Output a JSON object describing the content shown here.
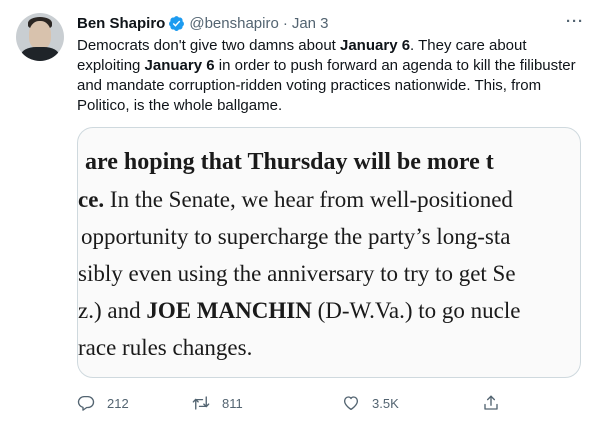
{
  "author": {
    "name": "Ben Shapiro",
    "handle": "@benshapiro",
    "separator": "·",
    "date": "Jan 3"
  },
  "more_label": "···",
  "tweet": {
    "parts": [
      "Democrats don't give two damns about ",
      "January 6",
      ". They care about exploiting ",
      "January 6",
      " in order to push forward an agenda to kill the filibuster and mandate corruption-ridden voting practices nationwide. This, from Politico, is the whole ballgame."
    ]
  },
  "media": {
    "lines": [
      "are hoping that Thursday will be more t",
      "ce. In the Senate, we hear from well-positioned",
      "opportunity to supercharge the party’s long-sta",
      "sibly even using the anniversary to try to get Se",
      "z.) and JOE MANCHIN (D-W.Va.) to go nucle",
      "race rules changes."
    ],
    "line1_bold": "ce.",
    "line1_rest": " In the Senate, we hear from well-positioned",
    "line4_a": "z.) and ",
    "line4_bold": "JOE MANCHIN",
    "line4_b": " (D-W.Va.) to go nucle"
  },
  "actions": {
    "reply": {
      "icon": "reply-icon",
      "count": "212"
    },
    "retweet": {
      "icon": "retweet-icon",
      "count": "811"
    },
    "like": {
      "icon": "heart-icon",
      "count": "3.5K"
    },
    "share": {
      "icon": "share-icon"
    }
  },
  "colors": {
    "text": "#0f1419",
    "secondary": "#536471",
    "verified": "#1d9bf0",
    "border": "#cfd9de"
  }
}
